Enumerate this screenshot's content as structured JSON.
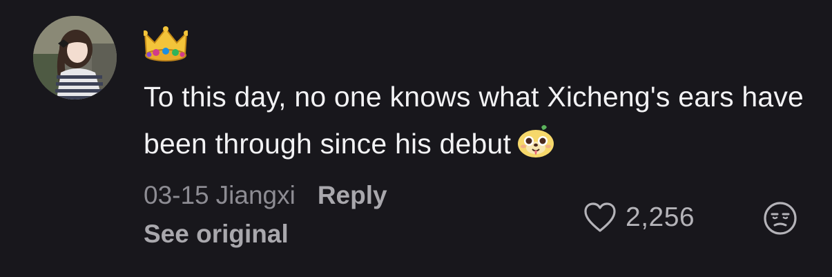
{
  "comment": {
    "badge_icon": "crown-icon",
    "avatar_icon": "user-avatar",
    "text": "To this day, no one knows what Xicheng's ears have been through since his debut",
    "text_emoji": "puppy-face-sticker",
    "date": "03-15",
    "location": "Jiangxi",
    "reply_label": "Reply",
    "see_original_label": "See original",
    "like_icon": "heart-outline-icon",
    "like_count": "2,256",
    "dislike_icon": "unamused-face-icon"
  },
  "colors": {
    "background": "#18171c",
    "text_primary": "#f2f2f4",
    "text_secondary": "#8d8c93",
    "action_text": "#a9a8ad"
  }
}
